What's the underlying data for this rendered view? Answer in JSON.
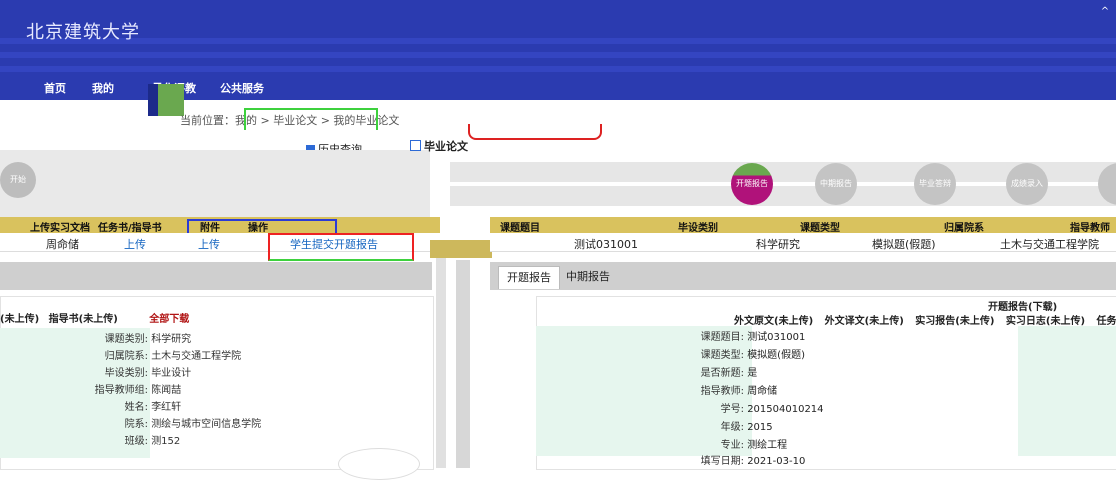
{
  "banner": {
    "logo_text": "北京建筑大学",
    "nav": [
      "首页",
      "我的",
      "量化评教",
      "公共服务"
    ]
  },
  "breadcrumb": {
    "text": "当前位置：我的 > 毕业论文 > 我的毕业论文"
  },
  "left": {
    "history_link": "历史查询",
    "flow_start": "开始",
    "columns": [
      "上传实习文档",
      "任务书/指导书",
      "附件",
      "操作"
    ],
    "row": {
      "teacher": "周命储",
      "upload1": "上传",
      "upload2": "上传",
      "action": "学生提交开题报告"
    },
    "actions": {
      "prefix": "(未上传)",
      "guide": "指导书(未上传)",
      "download_all": "全部下载"
    },
    "fields": [
      {
        "k": "课题类别:",
        "v": "科学研究"
      },
      {
        "k": "归属院系:",
        "v": "土木与交通工程学院"
      },
      {
        "k": "毕设类别:",
        "v": "毕业设计"
      },
      {
        "k": "指导教师组:",
        "v": "陈闻喆"
      },
      {
        "k": "姓名:",
        "v": "李红轩"
      },
      {
        "k": "院系:",
        "v": "测绘与城市空间信息学院"
      },
      {
        "k": "班级:",
        "v": "测152"
      }
    ]
  },
  "right": {
    "title": "毕业论文",
    "steps": [
      "开题报告",
      "中期报告",
      "毕业答辩",
      "成绩录入"
    ],
    "columns": [
      "课题题目",
      "毕设类别",
      "课题类型",
      "归属院系",
      "指导教师"
    ],
    "row": {
      "topic": "测试031001",
      "category": "科学研究",
      "type": "模拟题(假题)",
      "dept": "土木与交通工程学院"
    },
    "tabs": [
      "开题报告",
      "中期报告"
    ],
    "report_title": "开题报告(下载)",
    "actions": [
      "外文原文(未上传)",
      "外文译文(未上传)",
      "实习报告(未上传)",
      "实习日志(未上传)",
      "任务书(未"
    ],
    "fields": [
      {
        "k": "课题题目:",
        "v": "测试031001"
      },
      {
        "k": "课题类型:",
        "v": "模拟题(假题)"
      },
      {
        "k": "是否新题:",
        "v": "是"
      },
      {
        "k": "指导教师:",
        "v": "周命储"
      },
      {
        "k": "学号:",
        "v": "201504010214"
      },
      {
        "k": "年级:",
        "v": "2015"
      },
      {
        "k": "专业:",
        "v": "测绘工程"
      },
      {
        "k": "填写日期:",
        "v": "2021-03-10"
      }
    ]
  }
}
